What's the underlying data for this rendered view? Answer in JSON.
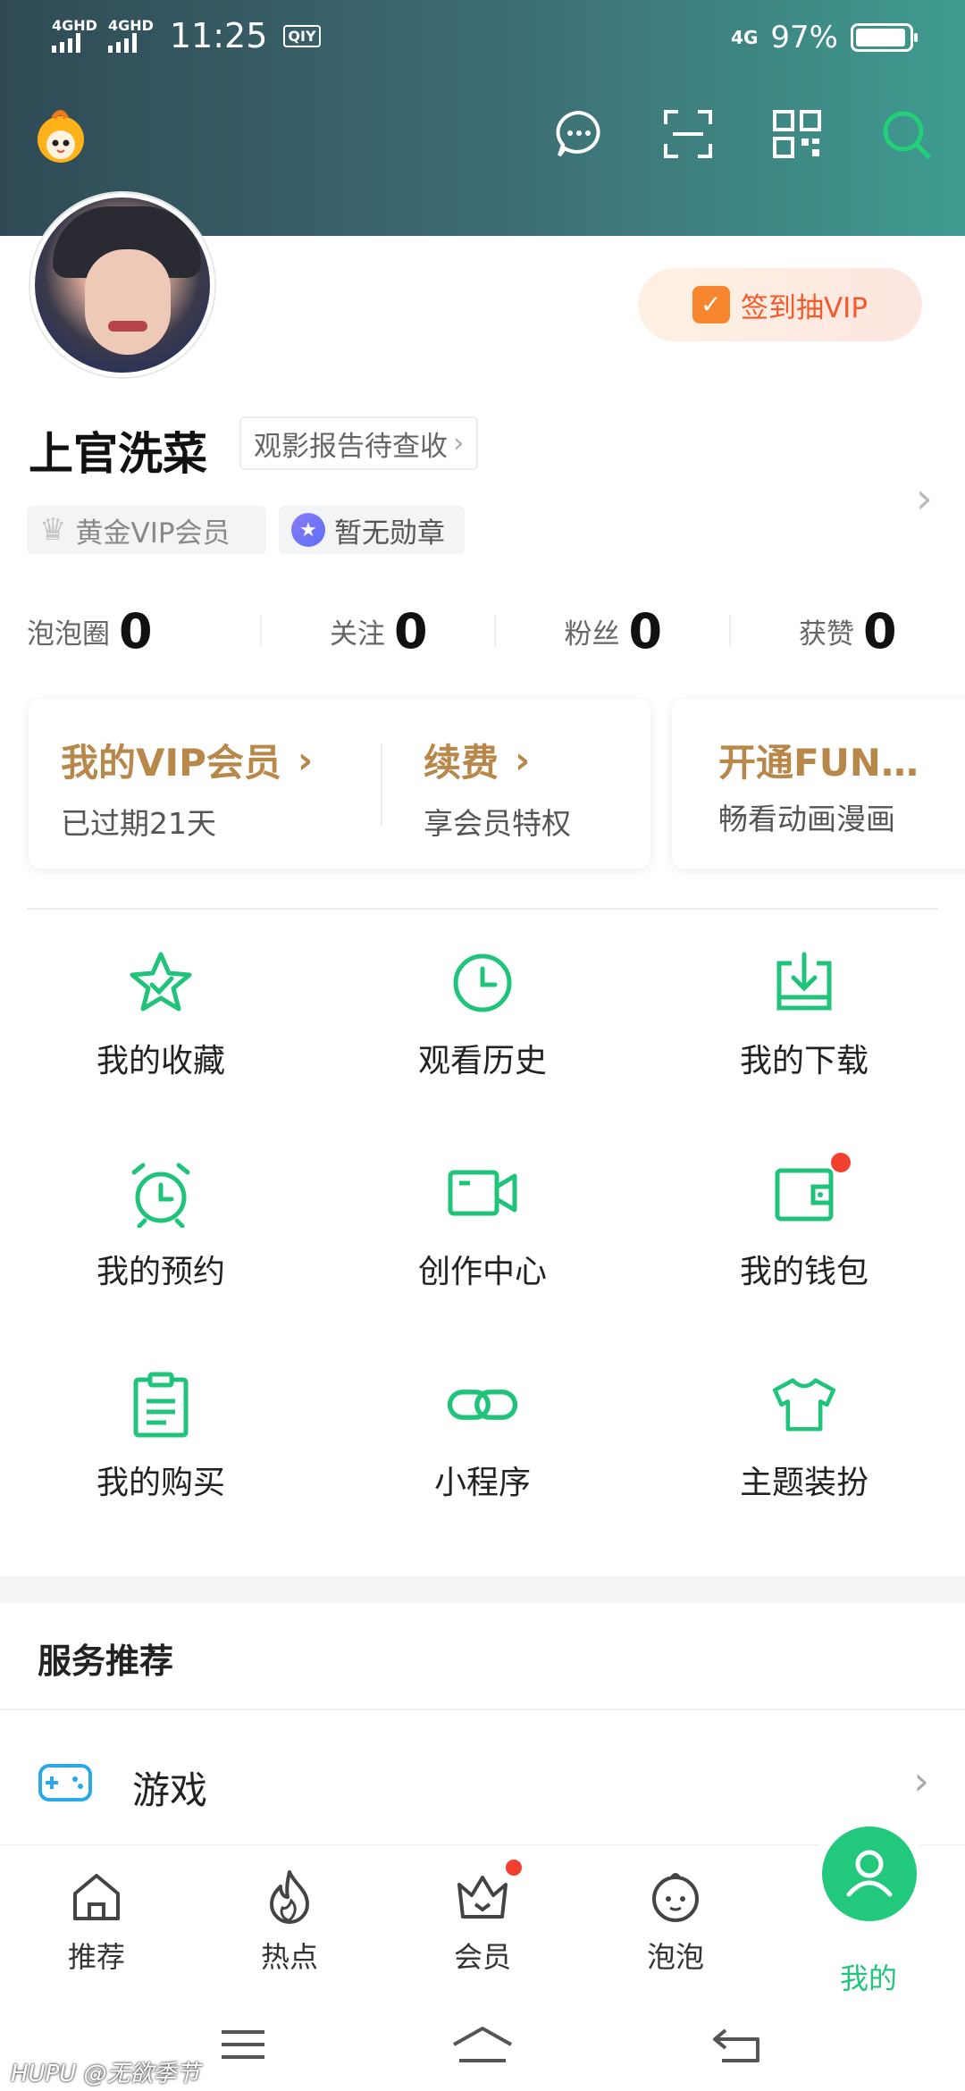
{
  "status_bar": {
    "network_1": "4GHD",
    "network_2": "4GHD",
    "time": "11:25",
    "app_badge": "QIY",
    "network_right": "4G",
    "battery": "97%",
    "battery_level": 0.97
  },
  "header": {
    "icons": [
      "message-icon",
      "scan-icon",
      "qrcode-icon",
      "search-icon"
    ],
    "accent": "#22c57a"
  },
  "profile": {
    "checkin_label": "签到抽VIP",
    "username": "上官洗菜",
    "report_tag": "观影报告待查收",
    "vip_badge": "黄金VIP会员",
    "medal_badge": "暂无勋章"
  },
  "stats": [
    {
      "label": "泡泡圈",
      "value": "0"
    },
    {
      "label": "关注",
      "value": "0"
    },
    {
      "label": "粉丝",
      "value": "0"
    },
    {
      "label": "获赞",
      "value": "0"
    }
  ],
  "vip_card": {
    "my_vip_title": "我的VIP会员",
    "my_vip_sub": "已过期21天",
    "renew_title": "续费",
    "renew_sub": "享会员特权",
    "fun_title": "开通FUN…",
    "fun_sub": "畅看动画漫画"
  },
  "grid": [
    {
      "label": "我的收藏",
      "icon": "star-icon"
    },
    {
      "label": "观看历史",
      "icon": "clock-icon"
    },
    {
      "label": "我的下载",
      "icon": "download-icon"
    },
    {
      "label": "我的预约",
      "icon": "alarm-clock-icon"
    },
    {
      "label": "创作中心",
      "icon": "video-camera-icon"
    },
    {
      "label": "我的钱包",
      "icon": "wallet-icon"
    },
    {
      "label": "我的购买",
      "icon": "clipboard-icon"
    },
    {
      "label": "小程序",
      "icon": "link-icon"
    },
    {
      "label": "主题装扮",
      "icon": "tshirt-icon"
    }
  ],
  "services": {
    "title": "服务推荐",
    "rows": [
      {
        "label": "游戏",
        "icon": "gamepad-icon"
      }
    ]
  },
  "bottom_nav": [
    {
      "label": "推荐",
      "icon": "home-icon"
    },
    {
      "label": "热点",
      "icon": "flame-icon"
    },
    {
      "label": "会员",
      "icon": "crown-icon"
    },
    {
      "label": "泡泡",
      "icon": "bubble-face-icon"
    },
    {
      "label": "我的",
      "icon": "user-icon",
      "active": true
    }
  ],
  "watermark": "HUPU @无欲季节"
}
